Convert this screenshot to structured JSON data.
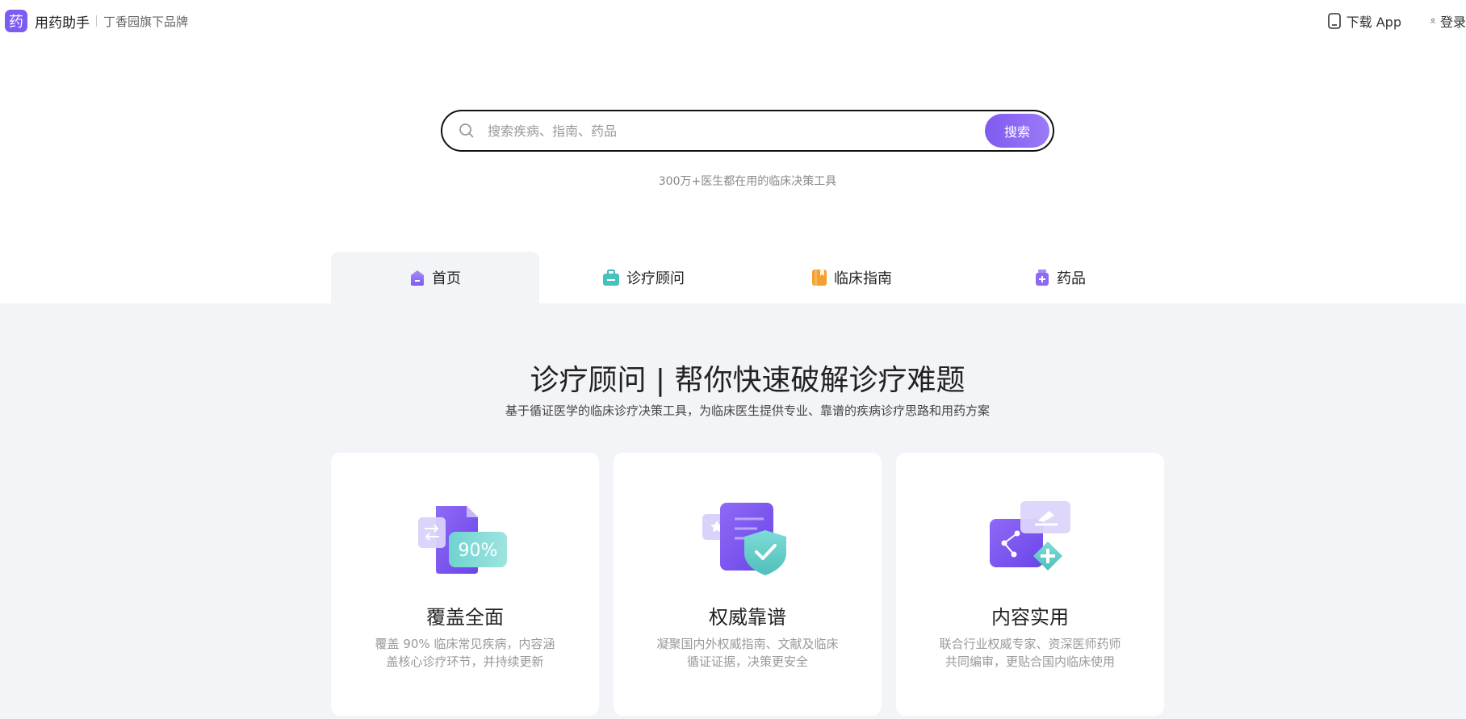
{
  "header": {
    "logo_glyph": "药",
    "app_name": "用药助手",
    "sub_brand": "丁香园旗下品牌",
    "download_label": "下载 App",
    "login_label": "登录"
  },
  "search": {
    "placeholder": "搜索疾病、指南、药品",
    "value": "",
    "button_label": "搜索",
    "tagline": "300万+医生都在用的临床决策工具"
  },
  "tabs": [
    {
      "label": "首页",
      "icon": "home-icon",
      "active": true
    },
    {
      "label": "诊疗顾问",
      "icon": "medical-kit-icon",
      "active": false
    },
    {
      "label": "临床指南",
      "icon": "book-icon",
      "active": false
    },
    {
      "label": "药品",
      "icon": "medicine-bottle-icon",
      "active": false
    }
  ],
  "section": {
    "title": "诊疗顾问 | 帮你快速破解诊疗难题",
    "subtitle": "基于循证医学的临床诊疗决策工具，为临床医生提供专业、靠谱的疾病诊疗思路和用药方案"
  },
  "cards": [
    {
      "title": "覆盖全面",
      "desc": "覆盖 90% 临床常见疾病，内容涵盖核心诊疗环节，并持续更新",
      "badge": "90%",
      "icon": "documents-coverage-icon"
    },
    {
      "title": "权威靠谱",
      "desc": "凝聚国内外权威指南、文献及临床循证证据，决策更安全",
      "icon": "shield-check-icon"
    },
    {
      "title": "内容实用",
      "desc": "联合行业权威专家、资深医师药师共同编审，更贴合国内临床使用",
      "icon": "share-plus-icon"
    }
  ],
  "colors": {
    "brand": "#7c5cf2",
    "section_bg": "#f3f4f8",
    "teal": "#5cc7c4",
    "orange": "#f5a02c"
  }
}
